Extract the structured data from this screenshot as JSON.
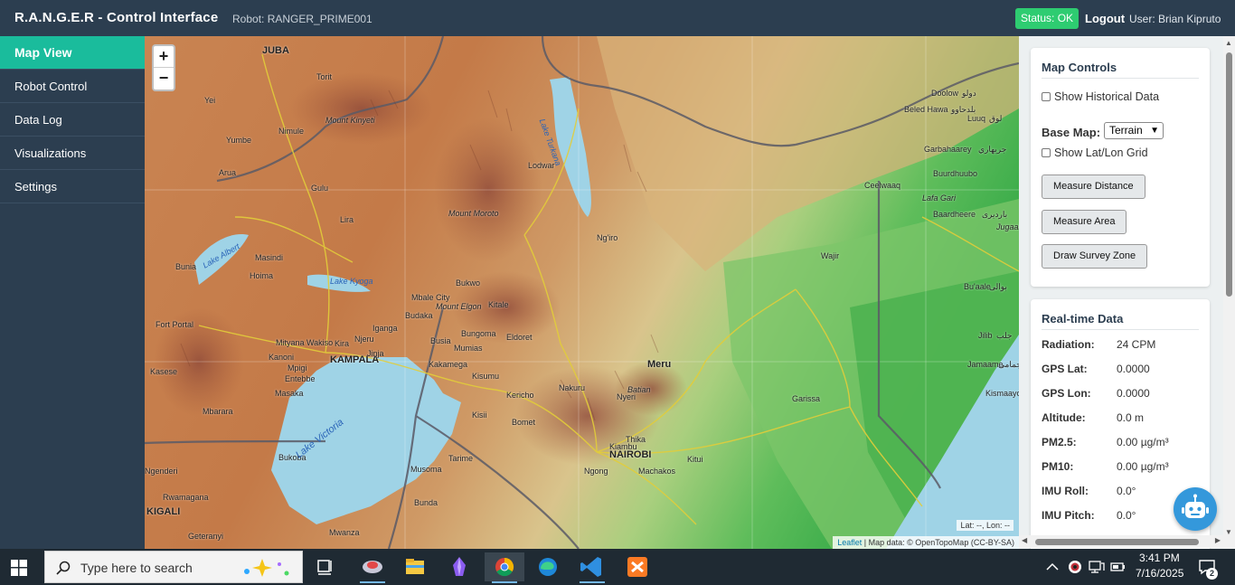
{
  "header": {
    "title": "R.A.N.G.E.R - Control Interface",
    "robot_label": "Robot: RANGER_PRIME001",
    "status": "Status: OK",
    "logout": "Logout",
    "user": "User: Brian Kipruto"
  },
  "sidebar": {
    "items": [
      {
        "label": "Map View",
        "active": true
      },
      {
        "label": "Robot Control",
        "active": false
      },
      {
        "label": "Data Log",
        "active": false
      },
      {
        "label": "Visualizations",
        "active": false
      },
      {
        "label": "Settings",
        "active": false
      }
    ]
  },
  "map": {
    "zoom_in": "+",
    "zoom_out": "−",
    "latlon_readout": "Lat: --, Lon: --",
    "attribution_leaflet": "Leaflet",
    "attribution_text": "| Map data: © OpenTopoMap (CC-BY-SA)",
    "labels": {
      "juba": "JUBA",
      "torit": "Torit",
      "yei": "Yei",
      "mount_kinyeti": "Mount Kinyeti",
      "yumbe": "Yumbe",
      "nimule": "Nimule",
      "arua": "Arua",
      "gulu": "Gulu",
      "lira": "Lira",
      "masindi": "Masindi",
      "hoima": "Hoima",
      "bunia": "Bunia",
      "lake_albert": "Lake Albert",
      "lake_kyoga": "Lake Kyoga",
      "fort_portal": "Fort Portal",
      "mityana_wakiso": "Mityana Wakiso",
      "kampala": "KAMPALA",
      "kasese": "Kasese",
      "kanoni": "Kanoni",
      "mpigi": "Mpigi",
      "entebbe": "Entebbe",
      "masaka": "Masaka",
      "mbarara": "Mbarara",
      "bukoba": "Bukoba",
      "lake_victoria": "Lake Victoria",
      "kigali": "KIGALI",
      "rwamagana": "Rwamagana",
      "ngenderi": "Ngenderi",
      "geteranyi": "Geteranyi",
      "mwanza": "Mwanza",
      "bunda": "Bunda",
      "musoma": "Musoma",
      "tarime": "Tarime",
      "kisumu": "Kisumu",
      "kakamega": "Kakamega",
      "mumias": "Mumias",
      "bungoma": "Bungoma",
      "eldoret": "Eldoret",
      "kitale": "Kitale",
      "mbale_city": "Mbale City",
      "mount_elgon": "Mount Elgon",
      "budaka": "Budaka",
      "bukwo": "Bukwo",
      "iganga": "Iganga",
      "njeru": "Njeru",
      "jinja": "Jinja",
      "kira": "Kira",
      "busia": "Busia",
      "kericho": "Kericho",
      "kisii": "Kisii",
      "bomet": "Bomet",
      "nakuru": "Nakuru",
      "nyeri": "Nyeri",
      "batian": "Batian",
      "meru": "Meru",
      "thika": "Thika",
      "kiambu": "Kiambu",
      "nairobi": "NAIROBI",
      "ngong": "Ngong",
      "machakos": "Machakos",
      "kitui": "Kitui",
      "garissa": "Garissa",
      "wajir": "Wajir",
      "lodwar": "Lodwar",
      "mount_moroto": "Mount Moroto",
      "lake_turkana": "Lake Turkana",
      "ngiro": "Ng'iro",
      "doolow": "Doolow",
      "doolow_ar": "دولو",
      "beled_hawa": "Beled Hawa",
      "beled_hawa_ar": "بلدحاوو",
      "luuq": "Luuq",
      "luuq_ar": "لوق",
      "garbahaarey": "Garbahaarey",
      "garbahaarey_ar": "جربهاري",
      "buurdhuubo": "Buurdhuubo",
      "ceelwaaq": "Ceelwaaq",
      "lafa_gari": "Lafa Gari",
      "baardheere": "Baardheere",
      "baardheere_ar": "بارديرى",
      "jugaala": "Jugaala",
      "buaale": "Bu'aale",
      "buaale_ar": "بوالى",
      "jilib": "Jilib",
      "jilib_ar": "جلب",
      "jamaame": "Jamaame",
      "jamaame_ar": "جمامى",
      "kismaayo": "Kismaayo"
    }
  },
  "map_controls": {
    "title": "Map Controls",
    "show_historical": "Show Historical Data",
    "base_map_label": "Base Map:",
    "base_map_value": "Terrain",
    "show_grid": "Show Lat/Lon Grid",
    "measure_distance": "Measure Distance",
    "measure_area": "Measure Area",
    "draw_survey_zone": "Draw Survey Zone"
  },
  "realtime": {
    "title": "Real-time Data",
    "rows": [
      {
        "label": "Radiation:",
        "value": "24 CPM"
      },
      {
        "label": "GPS Lat:",
        "value": "0.0000"
      },
      {
        "label": "GPS Lon:",
        "value": "0.0000"
      },
      {
        "label": "Altitude:",
        "value": "0.0 m"
      },
      {
        "label": "PM2.5:",
        "value": "0.00 µg/m³"
      },
      {
        "label": "PM10:",
        "value": "0.00 µg/m³"
      },
      {
        "label": "IMU Roll:",
        "value": "0.0°"
      },
      {
        "label": "IMU Pitch:",
        "value": "0.0°"
      }
    ]
  },
  "taskbar": {
    "search_placeholder": "Type here to search",
    "time": "3:41 PM",
    "date": "7/16/2025",
    "notifications": "2"
  },
  "colors": {
    "sidebar_bg": "#2c3e50",
    "active_nav": "#1abc9c",
    "status_ok": "#2ecc71",
    "chatbot": "#3498db"
  }
}
